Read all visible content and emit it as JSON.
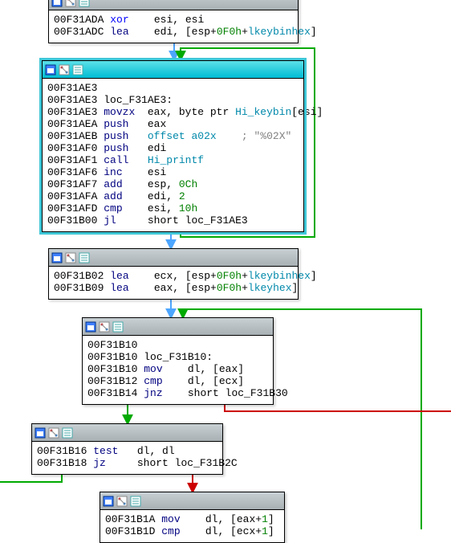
{
  "blocks": {
    "b1": {
      "lines": [
        {
          "addr": "00F31ADA",
          "mnem": "xor",
          "mnemClass": "mnem-blue",
          "rest": [
            {
              "t": "    esi, esi"
            }
          ]
        },
        {
          "addr": "00F31ADC",
          "mnem": "lea",
          "mnemClass": "mnem-navy",
          "rest": [
            {
              "t": "    edi, [esp+"
            },
            {
              "t": "0F0h",
              "c": "num-green"
            },
            {
              "t": "+"
            },
            {
              "t": "lkeybinhex",
              "c": "id-teal"
            },
            {
              "t": "]"
            }
          ]
        }
      ]
    },
    "b2": {
      "lines": [
        {
          "addr": "00F31AE3",
          "mnem": "",
          "mnemClass": "",
          "rest": []
        },
        {
          "addr": "00F31AE3",
          "mnem": "loc_F31AE3:",
          "mnemClass": "lbl",
          "rest": []
        },
        {
          "addr": "00F31AE3",
          "mnem": "movzx",
          "mnemClass": "mnem-navy",
          "rest": [
            {
              "t": "  eax, byte ptr "
            },
            {
              "t": "Hi_keybin",
              "c": "id-teal"
            },
            {
              "t": "[esi]"
            }
          ]
        },
        {
          "addr": "00F31AEA",
          "mnem": "push",
          "mnemClass": "mnem-navy",
          "rest": [
            {
              "t": "   eax"
            }
          ]
        },
        {
          "addr": "00F31AEB",
          "mnem": "push",
          "mnemClass": "mnem-navy",
          "rest": [
            {
              "t": "   "
            },
            {
              "t": "offset a02x",
              "c": "id-teal"
            },
            {
              "t": "    "
            },
            {
              "t": "; \"%02X\"",
              "c": "str-gray"
            }
          ]
        },
        {
          "addr": "00F31AF0",
          "mnem": "push",
          "mnemClass": "mnem-navy",
          "rest": [
            {
              "t": "   edi"
            }
          ]
        },
        {
          "addr": "00F31AF1",
          "mnem": "call",
          "mnemClass": "mnem-navy",
          "rest": [
            {
              "t": "   "
            },
            {
              "t": "Hi_printf",
              "c": "id-teal"
            }
          ]
        },
        {
          "addr": "00F31AF6",
          "mnem": "inc",
          "mnemClass": "mnem-navy",
          "rest": [
            {
              "t": "    esi"
            }
          ]
        },
        {
          "addr": "00F31AF7",
          "mnem": "add",
          "mnemClass": "mnem-navy",
          "rest": [
            {
              "t": "    esp, "
            },
            {
              "t": "0Ch",
              "c": "num-green"
            }
          ]
        },
        {
          "addr": "00F31AFA",
          "mnem": "add",
          "mnemClass": "mnem-navy",
          "rest": [
            {
              "t": "    edi, "
            },
            {
              "t": "2",
              "c": "num-green"
            }
          ]
        },
        {
          "addr": "00F31AFD",
          "mnem": "cmp",
          "mnemClass": "mnem-navy",
          "rest": [
            {
              "t": "    esi, "
            },
            {
              "t": "10h",
              "c": "num-green"
            }
          ]
        },
        {
          "addr": "00F31B00",
          "mnem": "jl",
          "mnemClass": "mnem-navy",
          "rest": [
            {
              "t": "     short "
            },
            {
              "t": "loc_F31AE3",
              "c": "lbl"
            }
          ]
        }
      ]
    },
    "b3": {
      "lines": [
        {
          "addr": "00F31B02",
          "mnem": "lea",
          "mnemClass": "mnem-navy",
          "rest": [
            {
              "t": "    ecx, [esp+"
            },
            {
              "t": "0F0h",
              "c": "num-green"
            },
            {
              "t": "+"
            },
            {
              "t": "lkeybinhex",
              "c": "id-teal"
            },
            {
              "t": "]"
            }
          ]
        },
        {
          "addr": "00F31B09",
          "mnem": "lea",
          "mnemClass": "mnem-navy",
          "rest": [
            {
              "t": "    eax, [esp+"
            },
            {
              "t": "0F0h",
              "c": "num-green"
            },
            {
              "t": "+"
            },
            {
              "t": "lkeyhex",
              "c": "id-teal"
            },
            {
              "t": "]"
            }
          ]
        }
      ]
    },
    "b4": {
      "lines": [
        {
          "addr": "00F31B10",
          "mnem": "",
          "mnemClass": "",
          "rest": []
        },
        {
          "addr": "00F31B10",
          "mnem": "loc_F31B10:",
          "mnemClass": "lbl",
          "rest": []
        },
        {
          "addr": "00F31B10",
          "mnem": "mov",
          "mnemClass": "mnem-navy",
          "rest": [
            {
              "t": "    dl, [eax]"
            }
          ]
        },
        {
          "addr": "00F31B12",
          "mnem": "cmp",
          "mnemClass": "mnem-navy",
          "rest": [
            {
              "t": "    dl, [ecx]"
            }
          ]
        },
        {
          "addr": "00F31B14",
          "mnem": "jnz",
          "mnemClass": "mnem-navy",
          "rest": [
            {
              "t": "    short "
            },
            {
              "t": "loc_F31B30",
              "c": "lbl"
            }
          ]
        }
      ]
    },
    "b5": {
      "lines": [
        {
          "addr": "00F31B16",
          "mnem": "test",
          "mnemClass": "mnem-navy",
          "rest": [
            {
              "t": "   dl, dl"
            }
          ]
        },
        {
          "addr": "00F31B18",
          "mnem": "jz",
          "mnemClass": "mnem-navy",
          "rest": [
            {
              "t": "     short "
            },
            {
              "t": "loc_F31B2C",
              "c": "lbl"
            }
          ]
        }
      ]
    },
    "b6": {
      "lines": [
        {
          "addr": "00F31B1A",
          "mnem": "mov",
          "mnemClass": "mnem-navy",
          "rest": [
            {
              "t": "    dl, [eax+"
            },
            {
              "t": "1",
              "c": "num-green"
            },
            {
              "t": "]"
            }
          ]
        },
        {
          "addr": "00F31B1D",
          "mnem": "cmp",
          "mnemClass": "mnem-navy",
          "rest": [
            {
              "t": "    dl, [ecx+"
            },
            {
              "t": "1",
              "c": "num-green"
            },
            {
              "t": "]"
            }
          ]
        }
      ]
    }
  }
}
